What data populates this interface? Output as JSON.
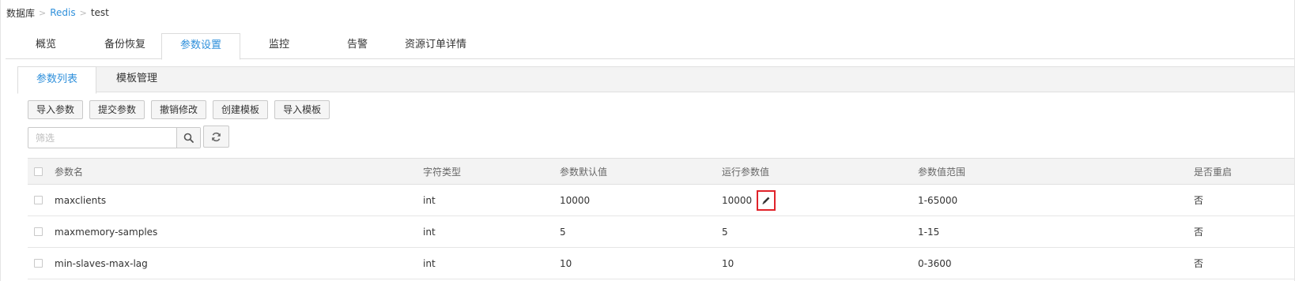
{
  "breadcrumb": {
    "root": "数据库",
    "service": "Redis",
    "instance": "test"
  },
  "main_tabs": [
    {
      "label": "概览",
      "active": false
    },
    {
      "label": "备份恢复",
      "active": false
    },
    {
      "label": "参数设置",
      "active": true
    },
    {
      "label": "监控",
      "active": false
    },
    {
      "label": "告警",
      "active": false
    },
    {
      "label": "资源订单详情",
      "active": false
    }
  ],
  "sub_tabs": [
    {
      "label": "参数列表",
      "active": true
    },
    {
      "label": "模板管理",
      "active": false
    }
  ],
  "toolbar": {
    "import_params": "导入参数",
    "submit_params": "提交参数",
    "undo_changes": "撤销修改",
    "create_template": "创建模板",
    "import_template": "导入模板"
  },
  "filter": {
    "placeholder": "筛选",
    "value": ""
  },
  "table": {
    "columns": [
      "参数名",
      "字符类型",
      "参数默认值",
      "运行参数值",
      "参数值范围",
      "是否重启"
    ],
    "rows": [
      {
        "name": "maxclients",
        "type": "int",
        "default": "10000",
        "running": "10000",
        "range": "1-65000",
        "restart": "否"
      },
      {
        "name": "maxmemory-samples",
        "type": "int",
        "default": "5",
        "running": "5",
        "range": "1-15",
        "restart": "否"
      },
      {
        "name": "min-slaves-max-lag",
        "type": "int",
        "default": "10",
        "running": "10",
        "range": "0-3600",
        "restart": "否"
      }
    ]
  },
  "icons": {
    "search": "search-icon",
    "refresh": "refresh-icon",
    "edit": "pencil-icon"
  },
  "colors": {
    "accent": "#2f90db",
    "highlight_border": "#e0232a"
  }
}
